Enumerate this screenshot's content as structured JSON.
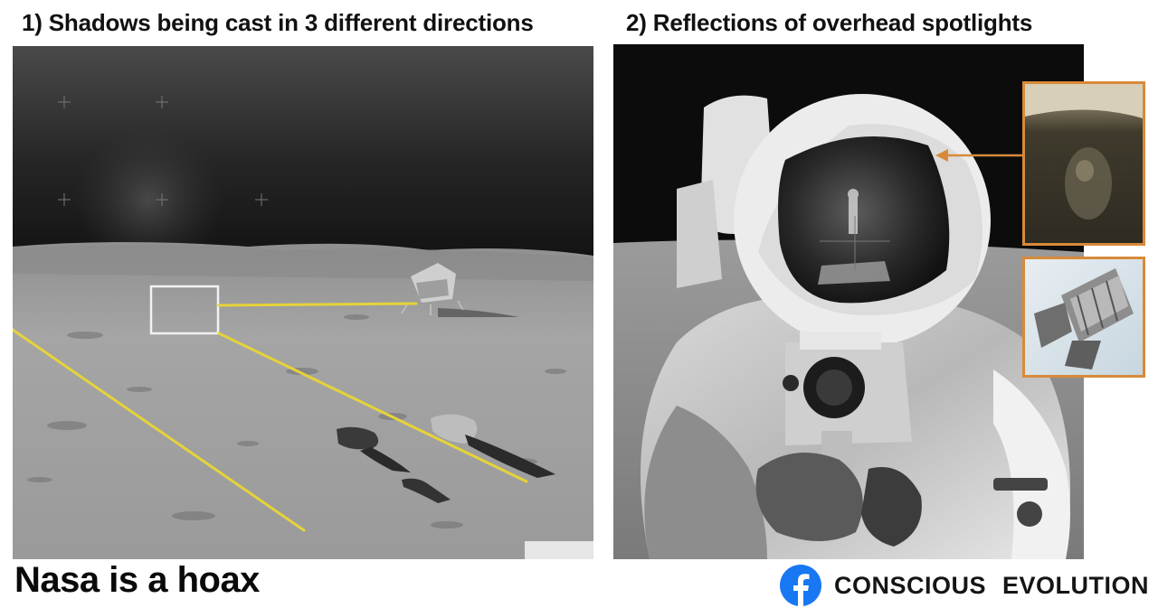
{
  "captions": {
    "left": "1) Shadows being cast in 3 different directions",
    "right": "2) Reflections of overhead spotlights"
  },
  "headline": "Nasa is a hoax",
  "brand": {
    "name": "CONSCIOUS  EVOLUTION",
    "icon": "facebook-icon",
    "icon_color": "#1877f2"
  },
  "colors": {
    "shadow_lines": "#e5d33a",
    "inset_border": "#d88a3a",
    "arrow": "#d88a3a"
  }
}
